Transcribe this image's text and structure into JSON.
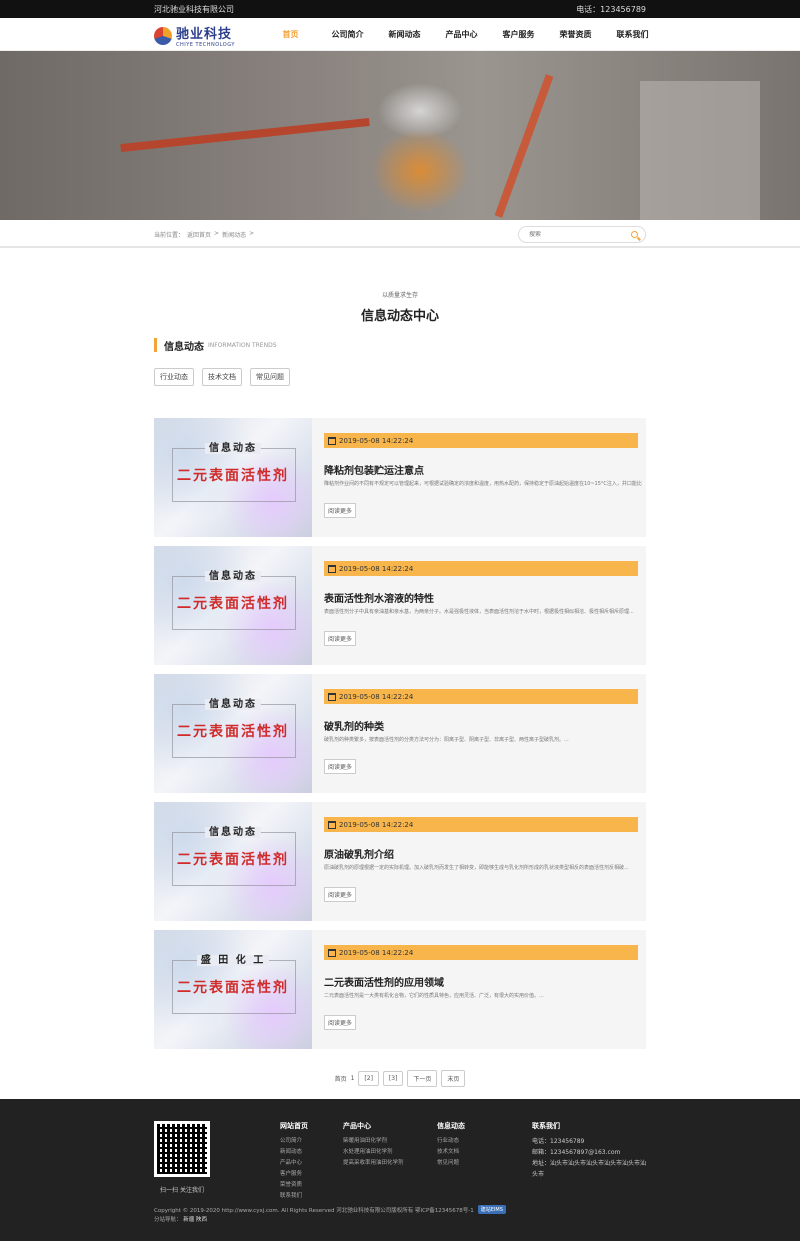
{
  "topbar": {
    "company": "河北驰业科技有限公司",
    "phone": "电话：123456789"
  },
  "logo": {
    "cn": "驰业科技",
    "en": "CHIYE TECHNOLOGY"
  },
  "nav": [
    "首页",
    "公司简介",
    "新闻动态",
    "产品中心",
    "客户服务",
    "荣誉资质",
    "联系我们"
  ],
  "breadcrumb": {
    "prefix": "当前位置：",
    "home": "返回首页",
    "sep1": ">",
    "current": "新闻动态",
    "sep2": ">"
  },
  "search": {
    "placeholder": "搜索"
  },
  "section": {
    "sub": "以质量求生存",
    "title": "信息动态中心"
  },
  "category": {
    "cn": "信息动态",
    "en": "INFORMATION TRENDS"
  },
  "tags": [
    "行业动态",
    "技术文档",
    "常见问题"
  ],
  "news": [
    {
      "thumb_top": "信息动态",
      "thumb_main": "二元表面活性剂",
      "date": "2019-05-08 14:22:24",
      "title": "降粘剂包装贮运注意点",
      "desc": "降粘剂作业间的不同有不规定可以管理起来，可根据试验确定的浓度和温度，用热水配药，保持稳定于原油起始温度在10~15°C注入，并口能比例更...",
      "more": "阅读更多"
    },
    {
      "thumb_top": "信息动态",
      "thumb_main": "二元表面活性剂",
      "date": "2019-05-08 14:22:24",
      "title": "表面活性剂水溶液的特性",
      "desc": "表面活性剂分子中具有亲油基和亲水基，为两亲分子。水是强极性液体，当表面活性剂溶于水中时，根据极性相似相溶、极性相斥相斥原理...",
      "more": "阅读更多"
    },
    {
      "thumb_top": "信息动态",
      "thumb_main": "二元表面活性剂",
      "date": "2019-05-08 14:22:24",
      "title": "破乳剂的种类",
      "desc": "破乳剂的种类繁多，按表面活性剂的分类方法可分为：阳离子型、阴离子型、非离子型、两性离子型破乳剂。...",
      "more": "阅读更多"
    },
    {
      "thumb_top": "信息动态",
      "thumb_main": "二元表面活性剂",
      "date": "2019-05-08 14:22:24",
      "title": "原油破乳剂介绍",
      "desc": "原油破乳剂的原理根据一定的实际机理。加入破乳剂而发生了相转变，即能够生成与乳化剂所形成的乳状液类型相反的表面活性剂反相破...",
      "more": "阅读更多"
    },
    {
      "thumb_top": "盛 田 化 工",
      "thumb_main": "二元表面活性剂",
      "date": "2019-05-08 14:22:24",
      "title": "二元表面活性剂的应用领域",
      "desc": "二元表面活性剂是一大类有机化合物，它们的性质具特色，应用灵活、广泛，有很大的实用价值。...",
      "more": "阅读更多"
    }
  ],
  "pager": {
    "first": "首页",
    "current": "1",
    "p2": "[2]",
    "p3": "[3]",
    "next": "下一页",
    "last": "末页"
  },
  "footer": {
    "qr_label": "扫一扫 关注我们",
    "col1": {
      "title": "网站首页",
      "links": [
        "公司简介",
        "新闻动态",
        "产品中心",
        "客户服务",
        "荣誉资质",
        "联系我们"
      ]
    },
    "col2": {
      "title": "产品中心",
      "links": [
        "柴暖用油田化学剂",
        "水处理用油田化学剂",
        "提高采收率用油田化学剂"
      ]
    },
    "col3": {
      "title": "信息动态",
      "links": [
        "行业动态",
        "技术文档",
        "常见问题"
      ]
    },
    "col4": {
      "title": "联系我们",
      "links": [
        "电话：123456789",
        "邮箱：1234567897@163.com",
        "地址：汕头市汕头市汕头市汕头市汕头市汕头市汕",
        "头市"
      ]
    },
    "copyright": "Copyright © 2019-2020 http://www.cyxj.com. All Rights Reserved 河北驰业科技有限公司版权所有 鄂ICP备12345678号-1",
    "badge": "建站EIMS",
    "sitemap_label": "分站导航：",
    "sitemap_links": [
      "新疆",
      "陕西"
    ]
  }
}
